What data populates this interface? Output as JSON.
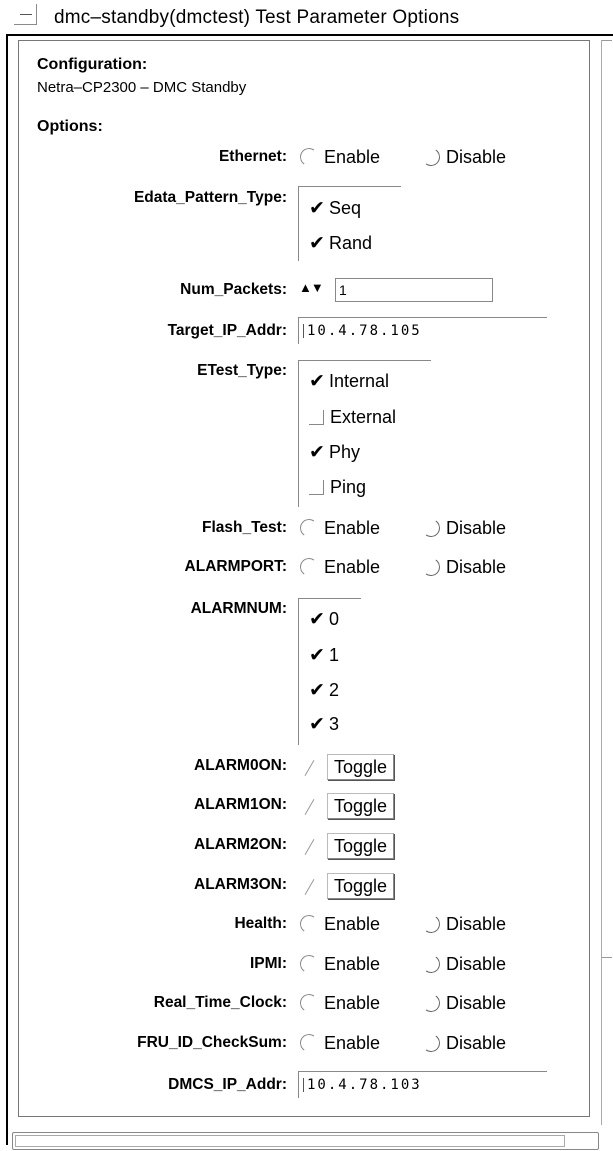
{
  "window": {
    "title": "dmc–standby(dmctest) Test Parameter Options"
  },
  "configuration": {
    "heading": "Configuration:",
    "value": "Netra–CP2300 – DMC Standby"
  },
  "options_heading": "Options:",
  "enable_label": "Enable",
  "disable_label": "Disable",
  "toggle_label": "Toggle",
  "ethernet": {
    "label": "Ethernet:"
  },
  "edata_pattern_type": {
    "label": "Edata_Pattern_Type:",
    "items": [
      {
        "label": "Seq",
        "checked": true
      },
      {
        "label": "Rand",
        "checked": true
      }
    ]
  },
  "num_packets": {
    "label": "Num_Packets:",
    "value": "1",
    "spin_glyph": "▲▼"
  },
  "target_ip": {
    "label": "Target_IP_Addr:",
    "value": "10.4.78.105"
  },
  "etest_type": {
    "label": "ETest_Type:",
    "items": [
      {
        "label": "Internal",
        "checked": true
      },
      {
        "label": "External",
        "checked": false
      },
      {
        "label": "Phy",
        "checked": true
      },
      {
        "label": "Ping",
        "checked": false
      }
    ]
  },
  "flash_test": {
    "label": "Flash_Test:"
  },
  "alarmport": {
    "label": "ALARMPORT:"
  },
  "alarmnum": {
    "label": "ALARMNUM:",
    "items": [
      {
        "label": "0",
        "checked": true
      },
      {
        "label": "1",
        "checked": true
      },
      {
        "label": "2",
        "checked": true
      },
      {
        "label": "3",
        "checked": true
      }
    ]
  },
  "alarm0on": {
    "label": "ALARM0ON:"
  },
  "alarm1on": {
    "label": "ALARM1ON:"
  },
  "alarm2on": {
    "label": "ALARM2ON:"
  },
  "alarm3on": {
    "label": "ALARM3ON:"
  },
  "health": {
    "label": "Health:"
  },
  "ipmi": {
    "label": "IPMI:"
  },
  "real_time_clock": {
    "label": "Real_Time_Clock:"
  },
  "fru_id_checksum": {
    "label": "FRU_ID_CheckSum:"
  },
  "dmcs_ip": {
    "label": "DMCS_IP_Addr:",
    "value": "10.4.78.103"
  },
  "check_glyph": "✔"
}
